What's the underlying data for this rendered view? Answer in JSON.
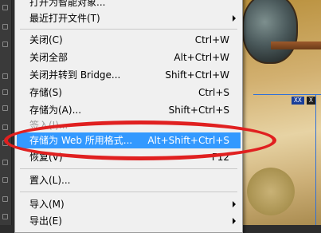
{
  "menu": {
    "items": [
      {
        "label": "打开为智能对象...",
        "shortcut": ""
      },
      {
        "label": "最近打开文件(T)",
        "shortcut": ""
      },
      {
        "label": "关闭(C)",
        "shortcut": "Ctrl+W"
      },
      {
        "label": "关闭全部",
        "shortcut": "Alt+Ctrl+W"
      },
      {
        "label": "关闭并转到 Bridge...",
        "shortcut": "Shift+Ctrl+W"
      },
      {
        "label": "存储(S)",
        "shortcut": "Ctrl+S"
      },
      {
        "label": "存储为(A)...",
        "shortcut": "Shift+Ctrl+S"
      },
      {
        "label": "签入(I)...",
        "shortcut": ""
      },
      {
        "label": "存储为 Web 所用格式...",
        "shortcut": "Alt+Shift+Ctrl+S"
      },
      {
        "label": "恢复(V)",
        "shortcut": "F12"
      },
      {
        "label": "置入(L)...",
        "shortcut": ""
      },
      {
        "label": "导入(M)",
        "shortcut": ""
      },
      {
        "label": "导出(E)",
        "shortcut": ""
      }
    ]
  },
  "canvas": {
    "tags": [
      "XX",
      "X"
    ]
  },
  "colors": {
    "highlight": "#3399ff",
    "annotation": "#e02020"
  }
}
